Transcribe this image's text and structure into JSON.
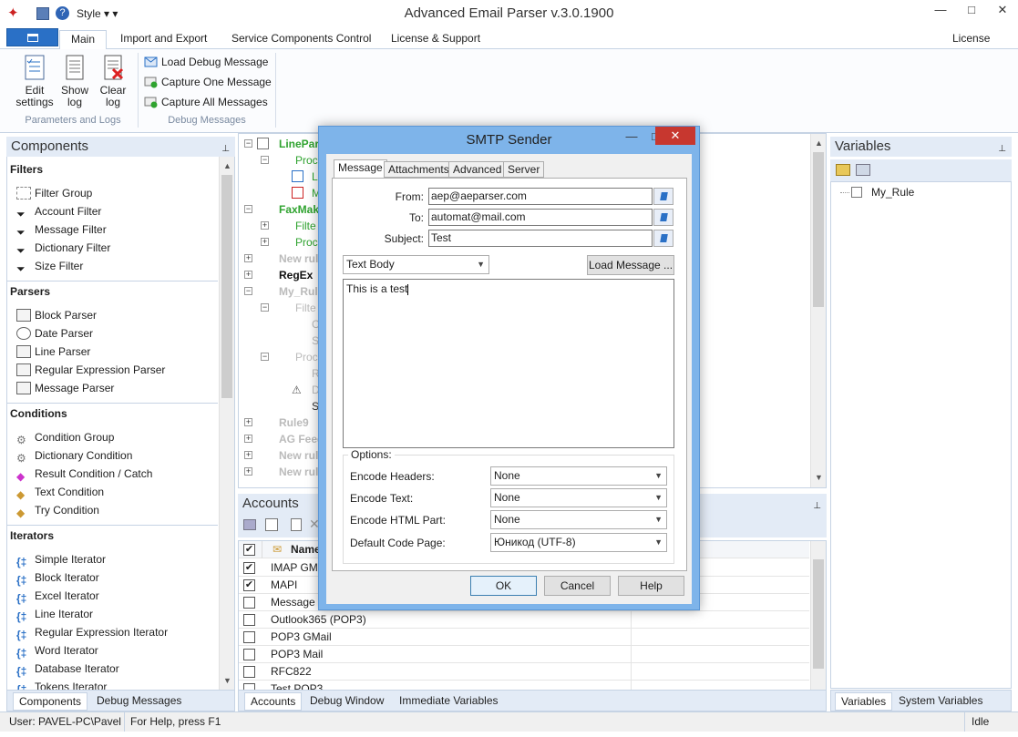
{
  "window": {
    "title": "Advanced Email Parser v.3.0.1900",
    "quick_access_style": "Style"
  },
  "ribbon": {
    "tabs": [
      {
        "label": "Main"
      },
      {
        "label": "Import and Export"
      },
      {
        "label": "Service Components Control"
      },
      {
        "label": "License & Support"
      }
    ],
    "license_info": "License info",
    "params_group": {
      "label": "Parameters and Logs",
      "buttons": [
        {
          "label": "Edit settings"
        },
        {
          "label": "Show log"
        },
        {
          "label": "Clear log"
        }
      ]
    },
    "debug_group": {
      "label": "Debug Messages",
      "buttons": [
        {
          "label": "Load Debug Message"
        },
        {
          "label": "Capture One Message"
        },
        {
          "label": "Capture All Messages"
        }
      ]
    }
  },
  "components": {
    "title": "Components",
    "sections": [
      {
        "title": "Filters",
        "items": [
          "Filter Group",
          "Account Filter",
          "Message Filter",
          "Dictionary Filter",
          "Size Filter"
        ]
      },
      {
        "title": "Parsers",
        "items": [
          "Block Parser",
          "Date Parser",
          "Line Parser",
          "Regular Expression Parser",
          "Message Parser"
        ]
      },
      {
        "title": "Conditions",
        "items": [
          "Condition Group",
          "Dictionary Condition",
          "Result Condition / Catch",
          "Text Condition",
          "Try Condition"
        ]
      },
      {
        "title": "Iterators",
        "items": [
          "Simple Iterator",
          "Block Iterator",
          "Excel Iterator",
          "Line Iterator",
          "Regular Expression Iterator",
          "Word Iterator",
          "Database Iterator",
          "Tokens Iterator"
        ]
      }
    ],
    "tabs": [
      "Components",
      "Debug Messages"
    ]
  },
  "tree": {
    "nodes": [
      "LineParser",
      "Proc",
      "L",
      "M",
      "FaxMak",
      "Filte",
      "Proc",
      "New rul",
      "RegEx",
      "My_Rule",
      "Filte",
      "C",
      "S",
      "Proc",
      "R",
      "D",
      "S",
      "Rule9",
      "AG Feed",
      "New rul",
      "New rul",
      "New rul"
    ]
  },
  "accounts": {
    "title": "Accounts",
    "column": "Name",
    "rows": [
      {
        "name": "IMAP GM",
        "checked": true
      },
      {
        "name": "MAPI",
        "checked": true
      },
      {
        "name": "Message T",
        "checked": false
      },
      {
        "name": "Outlook365 (POP3)",
        "checked": false
      },
      {
        "name": "POP3 GMail",
        "checked": false
      },
      {
        "name": "POP3 Mail",
        "checked": false
      },
      {
        "name": "RFC822",
        "checked": false
      },
      {
        "name": "Test POP3",
        "checked": false
      }
    ],
    "tabs": [
      "Accounts",
      "Debug Window",
      "Immediate Variables"
    ]
  },
  "variables": {
    "title": "Variables",
    "items": [
      "My_Rule"
    ],
    "tabs": [
      "Variables",
      "System Variables"
    ]
  },
  "status": {
    "user": "User: PAVEL-PC\\Pavel",
    "help": "For Help, press F1",
    "state": "Idle"
  },
  "dialog": {
    "title": "SMTP Sender",
    "tabs": [
      "Message",
      "Attachments",
      "Advanced",
      "Server"
    ],
    "from_label": "From:",
    "from_value": "aep@aeparser.com",
    "to_label": "To:",
    "to_value": "automat@mail.com",
    "subject_label": "Subject:",
    "subject_value": "Test",
    "body_type": "Text Body",
    "load_message": "Load Message ...",
    "body_text": "This is a test",
    "options_label": "Options:",
    "options": [
      {
        "label": "Encode Headers:",
        "value": "None"
      },
      {
        "label": "Encode Text:",
        "value": "None"
      },
      {
        "label": "Encode HTML Part:",
        "value": "None"
      },
      {
        "label": "Default Code Page:",
        "value": "Юникод (UTF-8)"
      }
    ],
    "ok": "OK",
    "cancel": "Cancel",
    "help": "Help"
  },
  "colors": {
    "accent": "#2a70c6",
    "panel_header": "#e3ebf6",
    "dialog_frame": "#7eb4ea",
    "close_red": "#c7372f",
    "tree_green": "#2fa32f"
  }
}
